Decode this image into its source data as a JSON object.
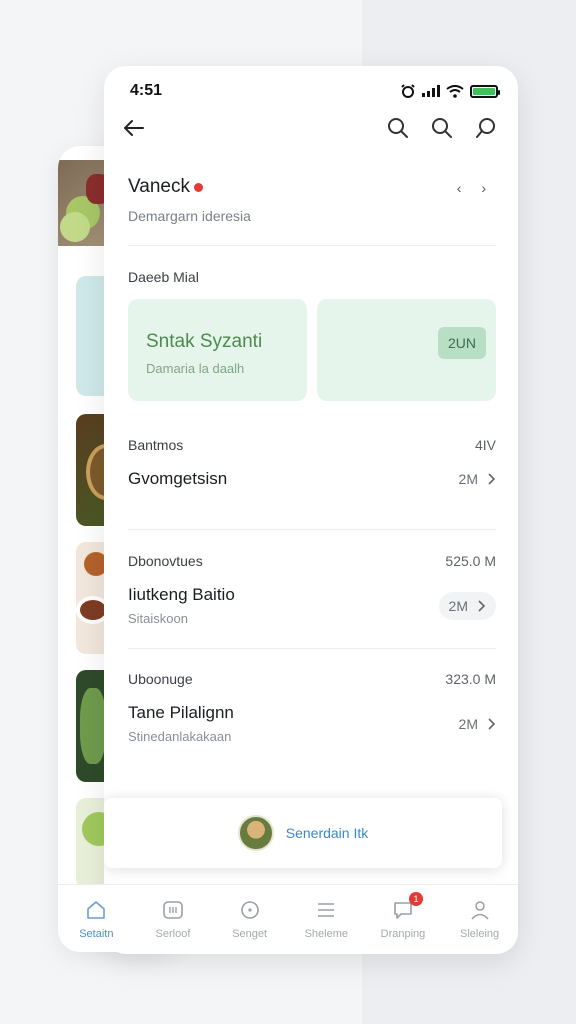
{
  "status_bar": {
    "time": "4:51"
  },
  "header": {
    "title": "Vaneck",
    "subtitle": "Demargarn ideresia",
    "arrows": "‹ ›"
  },
  "section_label": "Daeeb Mial",
  "tiles": {
    "main_title": "Sntak Syzanti",
    "main_subtitle": "Damaria la daalh",
    "chip": "2UN"
  },
  "rows": [
    {
      "head_left": "Bantmos",
      "head_right": "4IV",
      "title": "Gvomgetsisn",
      "subtitle": "",
      "value": "2M"
    },
    {
      "head_left": "Dbonovtues",
      "head_right": "525.0 M",
      "title": "Iiutkeng Baitio",
      "subtitle": "Sitaiskoon",
      "value": "2M"
    },
    {
      "head_left": "Uboonuge",
      "head_right": "323.0 M",
      "title": "Tane Pilalignn",
      "subtitle": "Stinedanlakakaan",
      "value": "2M"
    }
  ],
  "popup": {
    "text": "Senerdain Itk"
  },
  "bottom_nav": {
    "items": [
      {
        "label": "Setaitn",
        "icon": "home-icon"
      },
      {
        "label": "Serloof",
        "icon": "scan-icon"
      },
      {
        "label": "Senget",
        "icon": "search-icon"
      },
      {
        "label": "Sheleme",
        "icon": "list-icon"
      },
      {
        "label": "Dranping",
        "icon": "chat-icon",
        "badge": "1"
      },
      {
        "label": "Sleleing",
        "icon": "profile-icon"
      }
    ]
  },
  "colors": {
    "accent": "#4a8fcf",
    "tile_bg": "#e6f5ec",
    "tile_text": "#4c8b4e",
    "badge": "#e53935"
  }
}
